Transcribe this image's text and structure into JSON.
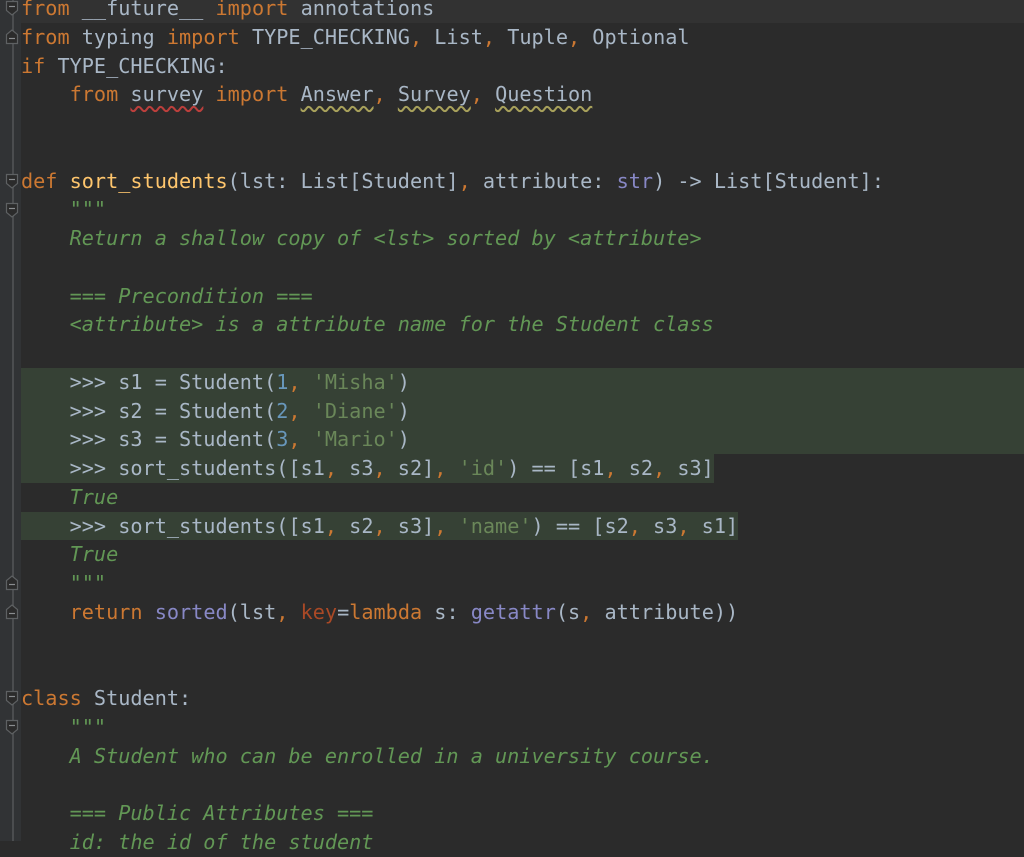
{
  "editor": {
    "language": "python",
    "lines": [
      {
        "tokens": [
          {
            "t": "from",
            "c": "kw"
          },
          {
            "t": " __future__ "
          },
          {
            "t": "import",
            "c": "kw"
          },
          {
            "t": " annotations"
          }
        ],
        "current": true
      },
      {
        "tokens": [
          {
            "t": "from",
            "c": "kw"
          },
          {
            "t": " typing "
          },
          {
            "t": "import",
            "c": "kw"
          },
          {
            "t": " TYPE_CHECKING"
          },
          {
            "t": ",",
            "c": "comma"
          },
          {
            "t": " List"
          },
          {
            "t": ",",
            "c": "comma"
          },
          {
            "t": " Tuple"
          },
          {
            "t": ",",
            "c": "comma"
          },
          {
            "t": " Optional"
          }
        ]
      },
      {
        "tokens": [
          {
            "t": "if",
            "c": "kw"
          },
          {
            "t": " TYPE_CHECKING:"
          }
        ]
      },
      {
        "tokens": [
          {
            "t": "    "
          },
          {
            "t": "from",
            "c": "kw"
          },
          {
            "t": " "
          },
          {
            "t": "survey",
            "c": "wavy-red"
          },
          {
            "t": " "
          },
          {
            "t": "import",
            "c": "kw"
          },
          {
            "t": " "
          },
          {
            "t": "Answer",
            "c": "wavy-yellow"
          },
          {
            "t": ",",
            "c": "comma"
          },
          {
            "t": " "
          },
          {
            "t": "Survey",
            "c": "wavy-yellow"
          },
          {
            "t": ",",
            "c": "comma"
          },
          {
            "t": " "
          },
          {
            "t": "Question",
            "c": "wavy-yellow"
          }
        ]
      },
      {
        "tokens": []
      },
      {
        "tokens": []
      },
      {
        "tokens": [
          {
            "t": "def",
            "c": "kw"
          },
          {
            "t": " "
          },
          {
            "t": "sort_students",
            "c": "fn"
          },
          {
            "t": "(lst: List[Student]"
          },
          {
            "t": ",",
            "c": "comma"
          },
          {
            "t": " attribute: "
          },
          {
            "t": "str",
            "c": "builtin"
          },
          {
            "t": ") -> List[Student]:"
          }
        ]
      },
      {
        "tokens": [
          {
            "t": "    "
          },
          {
            "t": "\"\"\"",
            "c": "docq"
          }
        ]
      },
      {
        "tokens": [
          {
            "t": "    Return a shallow copy of <lst> sorted by <attribute>",
            "c": "doc"
          }
        ]
      },
      {
        "tokens": []
      },
      {
        "tokens": [
          {
            "t": "    === Precondition ===",
            "c": "doc"
          }
        ]
      },
      {
        "tokens": [
          {
            "t": "    <attribute> is a attribute name for the Student class",
            "c": "doc"
          }
        ]
      },
      {
        "tokens": []
      },
      {
        "tokens": [
          {
            "t": "    >>> s1 = Student("
          },
          {
            "t": "1",
            "c": "num"
          },
          {
            "t": ",",
            "c": "comma"
          },
          {
            "t": " "
          },
          {
            "t": "'Misha'",
            "c": "str"
          },
          {
            "t": ")"
          }
        ],
        "highlight": "full"
      },
      {
        "tokens": [
          {
            "t": "    >>> s2 = Student("
          },
          {
            "t": "2",
            "c": "num"
          },
          {
            "t": ",",
            "c": "comma"
          },
          {
            "t": " "
          },
          {
            "t": "'Diane'",
            "c": "str"
          },
          {
            "t": ")"
          }
        ],
        "highlight": "full"
      },
      {
        "tokens": [
          {
            "t": "    >>> s3 = Student("
          },
          {
            "t": "3",
            "c": "num"
          },
          {
            "t": ",",
            "c": "comma"
          },
          {
            "t": " "
          },
          {
            "t": "'Mario'",
            "c": "str"
          },
          {
            "t": ")"
          }
        ],
        "highlight": "full"
      },
      {
        "tokens": [
          {
            "t": "    >>> sort_students([s1"
          },
          {
            "t": ",",
            "c": "comma"
          },
          {
            "t": " s3"
          },
          {
            "t": ",",
            "c": "comma"
          },
          {
            "t": " s2]"
          },
          {
            "t": ",",
            "c": "comma"
          },
          {
            "t": " "
          },
          {
            "t": "'id'",
            "c": "str"
          },
          {
            "t": ") == [s1"
          },
          {
            "t": ",",
            "c": "comma"
          },
          {
            "t": " s2"
          },
          {
            "t": ",",
            "c": "comma"
          },
          {
            "t": " s3]"
          }
        ],
        "highlight": "partial"
      },
      {
        "tokens": [
          {
            "t": "    True",
            "c": "doc"
          }
        ]
      },
      {
        "tokens": [
          {
            "t": "    >>> sort_students([s1"
          },
          {
            "t": ",",
            "c": "comma"
          },
          {
            "t": " s2"
          },
          {
            "t": ",",
            "c": "comma"
          },
          {
            "t": " s3]"
          },
          {
            "t": ",",
            "c": "comma"
          },
          {
            "t": " "
          },
          {
            "t": "'name'",
            "c": "str"
          },
          {
            "t": ") == [s2"
          },
          {
            "t": ",",
            "c": "comma"
          },
          {
            "t": " s3"
          },
          {
            "t": ",",
            "c": "comma"
          },
          {
            "t": " s1]"
          }
        ],
        "highlight": "partial"
      },
      {
        "tokens": [
          {
            "t": "    True",
            "c": "doc"
          }
        ]
      },
      {
        "tokens": [
          {
            "t": "    "
          },
          {
            "t": "\"\"\"",
            "c": "docq"
          }
        ]
      },
      {
        "tokens": [
          {
            "t": "    "
          },
          {
            "t": "return",
            "c": "kw"
          },
          {
            "t": " "
          },
          {
            "t": "sorted",
            "c": "builtin"
          },
          {
            "t": "(lst"
          },
          {
            "t": ",",
            "c": "comma"
          },
          {
            "t": " "
          },
          {
            "t": "key",
            "c": "param-kw"
          },
          {
            "t": "="
          },
          {
            "t": "lambda",
            "c": "kw"
          },
          {
            "t": " s: "
          },
          {
            "t": "getattr",
            "c": "builtin"
          },
          {
            "t": "(s"
          },
          {
            "t": ",",
            "c": "comma"
          },
          {
            "t": " attribute))"
          }
        ]
      },
      {
        "tokens": []
      },
      {
        "tokens": []
      },
      {
        "tokens": [
          {
            "t": "class",
            "c": "kw"
          },
          {
            "t": " Student:"
          }
        ]
      },
      {
        "tokens": [
          {
            "t": "    "
          },
          {
            "t": "\"\"\"",
            "c": "docq"
          }
        ]
      },
      {
        "tokens": [
          {
            "t": "    A Student who can be enrolled in a university course.",
            "c": "doc"
          }
        ]
      },
      {
        "tokens": []
      },
      {
        "tokens": [
          {
            "t": "    === Public Attributes ===",
            "c": "doc"
          }
        ]
      },
      {
        "tokens": [
          {
            "t": "    id: the id of the student",
            "c": "doc"
          }
        ]
      }
    ],
    "fold_markers": [
      {
        "line": 0,
        "type": "open"
      },
      {
        "line": 1,
        "type": "close"
      },
      {
        "line": 6,
        "type": "open"
      },
      {
        "line": 7,
        "type": "open"
      },
      {
        "line": 20,
        "type": "close"
      },
      {
        "line": 21,
        "type": "close"
      },
      {
        "line": 24,
        "type": "open"
      },
      {
        "line": 25,
        "type": "open"
      }
    ]
  }
}
